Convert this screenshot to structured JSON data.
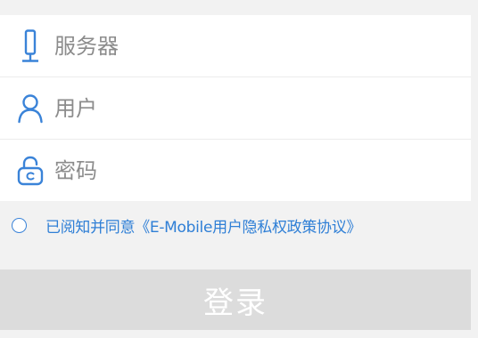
{
  "form": {
    "server": {
      "icon": "server-icon",
      "placeholder": "服务器",
      "value": ""
    },
    "user": {
      "icon": "user-icon",
      "placeholder": "用户",
      "value": ""
    },
    "password": {
      "icon": "unlock-icon",
      "placeholder": "密码",
      "value": ""
    }
  },
  "agreement": {
    "text": "已阅知并同意《E-Mobile用户隐私权政策协议》",
    "checked": false
  },
  "login": {
    "label": "登录"
  },
  "colors": {
    "accent": "#2f7fd6",
    "icon": "#3a83d8",
    "button_disabled": "#dcdcdc",
    "background": "#f2f2f2"
  }
}
